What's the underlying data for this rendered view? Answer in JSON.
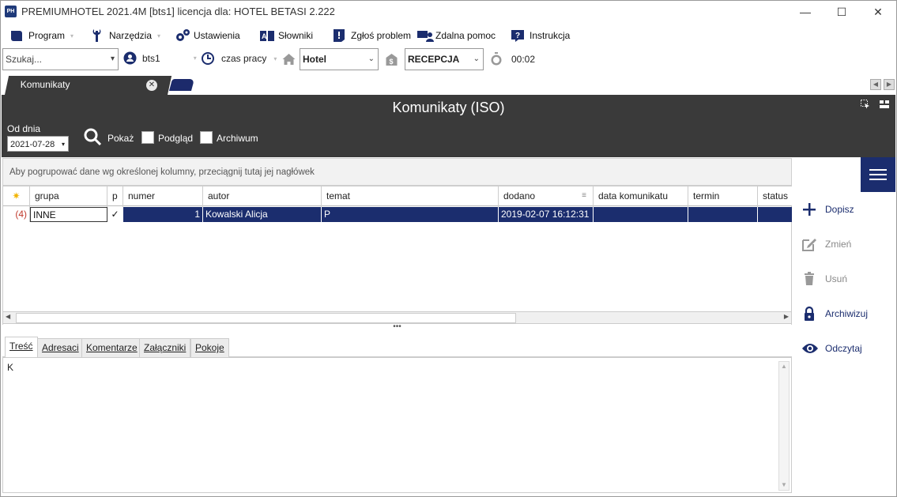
{
  "window": {
    "title": "PREMIUMHOTEL 2021.4M [bts1] licencja dla: HOTEL BETASI 2.222",
    "app_icon_text": "PH",
    "minimize": "—",
    "maximize": "☐",
    "close": "✕"
  },
  "menu": [
    {
      "label": "Program",
      "icon": "book-icon"
    },
    {
      "label": "Narzędzia",
      "icon": "wrench-icon"
    },
    {
      "label": "Ustawienia",
      "icon": "gears-icon"
    },
    {
      "label": "Słowniki",
      "icon": "dictionary-icon"
    },
    {
      "label": "Zgłoś problem",
      "icon": "alert-icon"
    },
    {
      "label": "Zdalna pomoc",
      "icon": "remote-help-icon"
    },
    {
      "label": "Instrukcja",
      "icon": "manual-icon"
    }
  ],
  "toolbar": {
    "search_placeholder": "Szukaj...",
    "user": "bts1",
    "work_time": "czas pracy",
    "hotel": "Hotel",
    "department": "RECEPCJA",
    "timer": "00:02"
  },
  "tabs": {
    "active": "Komunikaty",
    "close": "✕"
  },
  "panel": {
    "title": "Komunikaty (ISO)",
    "date_label": "Od dnia",
    "date_value": "2021-07-28",
    "show_label": "Pokaż",
    "preview_label": "Podgląd",
    "archive_label": "Archiwum"
  },
  "grid": {
    "group_hint": "Aby pogrupować dane wg określonej kolumny, przeciągnij tutaj jej nagłówek",
    "columns": [
      "grupa",
      "p",
      "numer",
      "autor",
      "temat",
      "dodano",
      "data komunikatu",
      "termin ważności",
      "status"
    ],
    "row": {
      "count": "(4)",
      "grupa": "INNE",
      "p": "✓",
      "numer": "1",
      "autor": "Kowalski Alicja",
      "temat": "P",
      "dodano": "2019-02-07 16:12:31",
      "data_komunikatu": "",
      "termin_waznosci": "",
      "status": ""
    }
  },
  "detail_tabs": [
    "Treść",
    "Adresaci",
    "Komentarze",
    "Załączniki",
    "Pokoje"
  ],
  "detail_content": "K",
  "actions": [
    {
      "label": "Dopisz",
      "enabled": true
    },
    {
      "label": "Zmień",
      "enabled": false
    },
    {
      "label": "Usuń",
      "enabled": false
    },
    {
      "label": "Archiwizuj",
      "enabled": true
    },
    {
      "label": "Odczytaj",
      "enabled": true
    }
  ],
  "colors": {
    "accent": "#1b2d6e",
    "dark_panel": "#3a3a3a"
  }
}
